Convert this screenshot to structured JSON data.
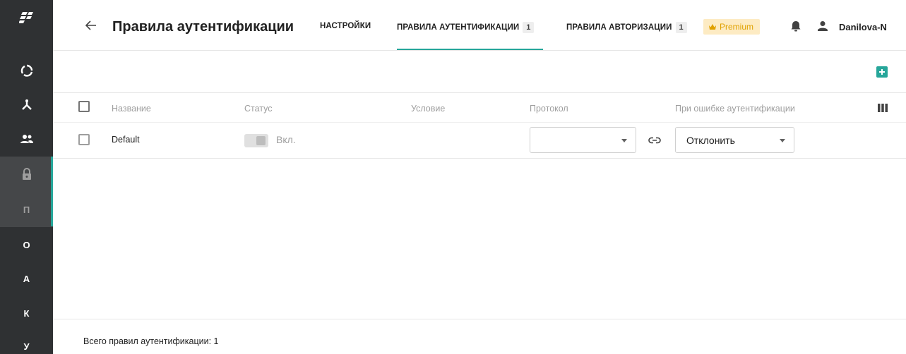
{
  "sidebar": {
    "items": [
      {
        "icon": "logo-icon"
      },
      {
        "icon": "refresh-circle-icon"
      },
      {
        "icon": "hierarchy-icon"
      },
      {
        "icon": "users-icon"
      },
      {
        "icon": "lock-icon"
      },
      {
        "letter": "П"
      },
      {
        "letter": "О"
      },
      {
        "letter": "А"
      },
      {
        "letter": "К"
      },
      {
        "letter": "У"
      }
    ]
  },
  "header": {
    "title": "Правила аутентификации",
    "tabs": [
      {
        "label": "НАСТРОЙКИ",
        "count": ""
      },
      {
        "label": "ПРАВИЛА АУТЕНТИФИКАЦИИ",
        "count": "1"
      },
      {
        "label": "ПРАВИЛА АВТОРИЗАЦИИ",
        "count": "1"
      }
    ],
    "premium_label": "Premium",
    "user_name": "Danilova-N"
  },
  "table": {
    "columns": [
      "Название",
      "Статус",
      "Условие",
      "Протокол",
      "При ошибке аутентификации"
    ],
    "rows": [
      {
        "name": "Default",
        "status_label": "Вкл.",
        "condition": "",
        "protocol": "",
        "on_error": "Отклонить"
      }
    ]
  },
  "footer": {
    "total_text": "Всего правил аутентификации: 1"
  },
  "colors": {
    "accent": "#26a69a",
    "sidebar_bg": "#2f3133",
    "premium_bg": "#fdebc3",
    "premium_text": "#e0a100"
  }
}
